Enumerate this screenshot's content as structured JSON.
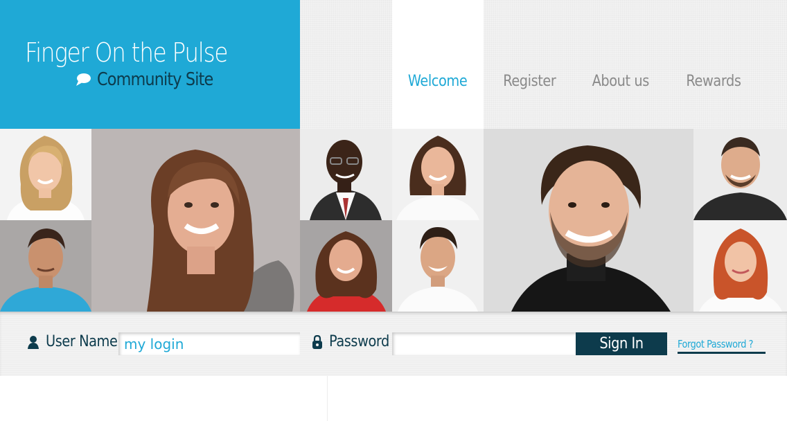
{
  "brand": {
    "title": "Finger On the Pulse",
    "subtitle": "Community Site",
    "color": "#1fa9d6"
  },
  "nav": {
    "items": [
      {
        "label": "Welcome",
        "active": true
      },
      {
        "label": "Register",
        "active": false
      },
      {
        "label": "About us",
        "active": false
      },
      {
        "label": "Rewards",
        "active": false
      }
    ]
  },
  "photos": [
    "blonde-woman",
    "woman-long-brown-hair",
    "man-suit-glasses",
    "woman-white-shirt",
    "man-dark-sweater",
    "man-bald-beard",
    "man-blue-shirt",
    "woman-red-top",
    "man-white-shirt",
    "red-haired-woman"
  ],
  "login": {
    "username_label": "User Name",
    "username_value": "my login",
    "password_label": "Password",
    "password_value": "",
    "signin_label": "Sign In",
    "forgot_label": "Forgot Password ?"
  },
  "icons": {
    "user": "user-icon",
    "lock": "lock-icon",
    "chat": "chat-bubble-icon"
  },
  "colors": {
    "accent": "#1fa9d6",
    "dark": "#0d3b4c",
    "nav_text": "#8a8a8a"
  }
}
